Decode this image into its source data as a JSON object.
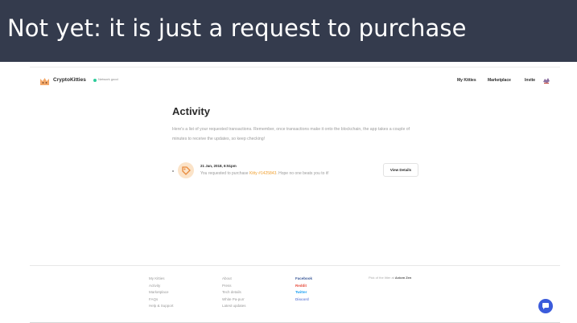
{
  "slide": {
    "title": "Not yet: it is just a request to purchase"
  },
  "nav": {
    "brand": "CryptoKitties",
    "network": "Network good",
    "links": [
      "My Kitties",
      "Marketplace",
      "Invite"
    ]
  },
  "activity": {
    "title": "Activity",
    "description": "Here's a list of your requested transactions. Remember, once transactions make it onto the blockchain, the app takes a couple of minutes to receive the updates, so keep checking!",
    "transaction": {
      "date": "21 Jan, 2018, 6:51pm",
      "message_prefix": "You requested to purchase ",
      "kitty": "Kitty #1425843",
      "message_suffix": ". Hope no one beats you to it!",
      "button": "View Details"
    }
  },
  "footer": {
    "col1": [
      "My Kitties",
      "Activity",
      "Marketplace",
      "FAQs",
      "Help & Support"
    ],
    "col2": [
      "About",
      "Press",
      "Tech details",
      "White Pa-purr",
      "Latest updates"
    ],
    "social": [
      "Facebook",
      "Reddit",
      "Twitter",
      "Discord"
    ],
    "pick_prefix": "Pick of the litter at ",
    "pick_name": "Axiom Zen"
  },
  "colors": {
    "header_bg": "#343b4d",
    "kitty_link": "#f0a030",
    "chat": "#3b5bdb"
  }
}
